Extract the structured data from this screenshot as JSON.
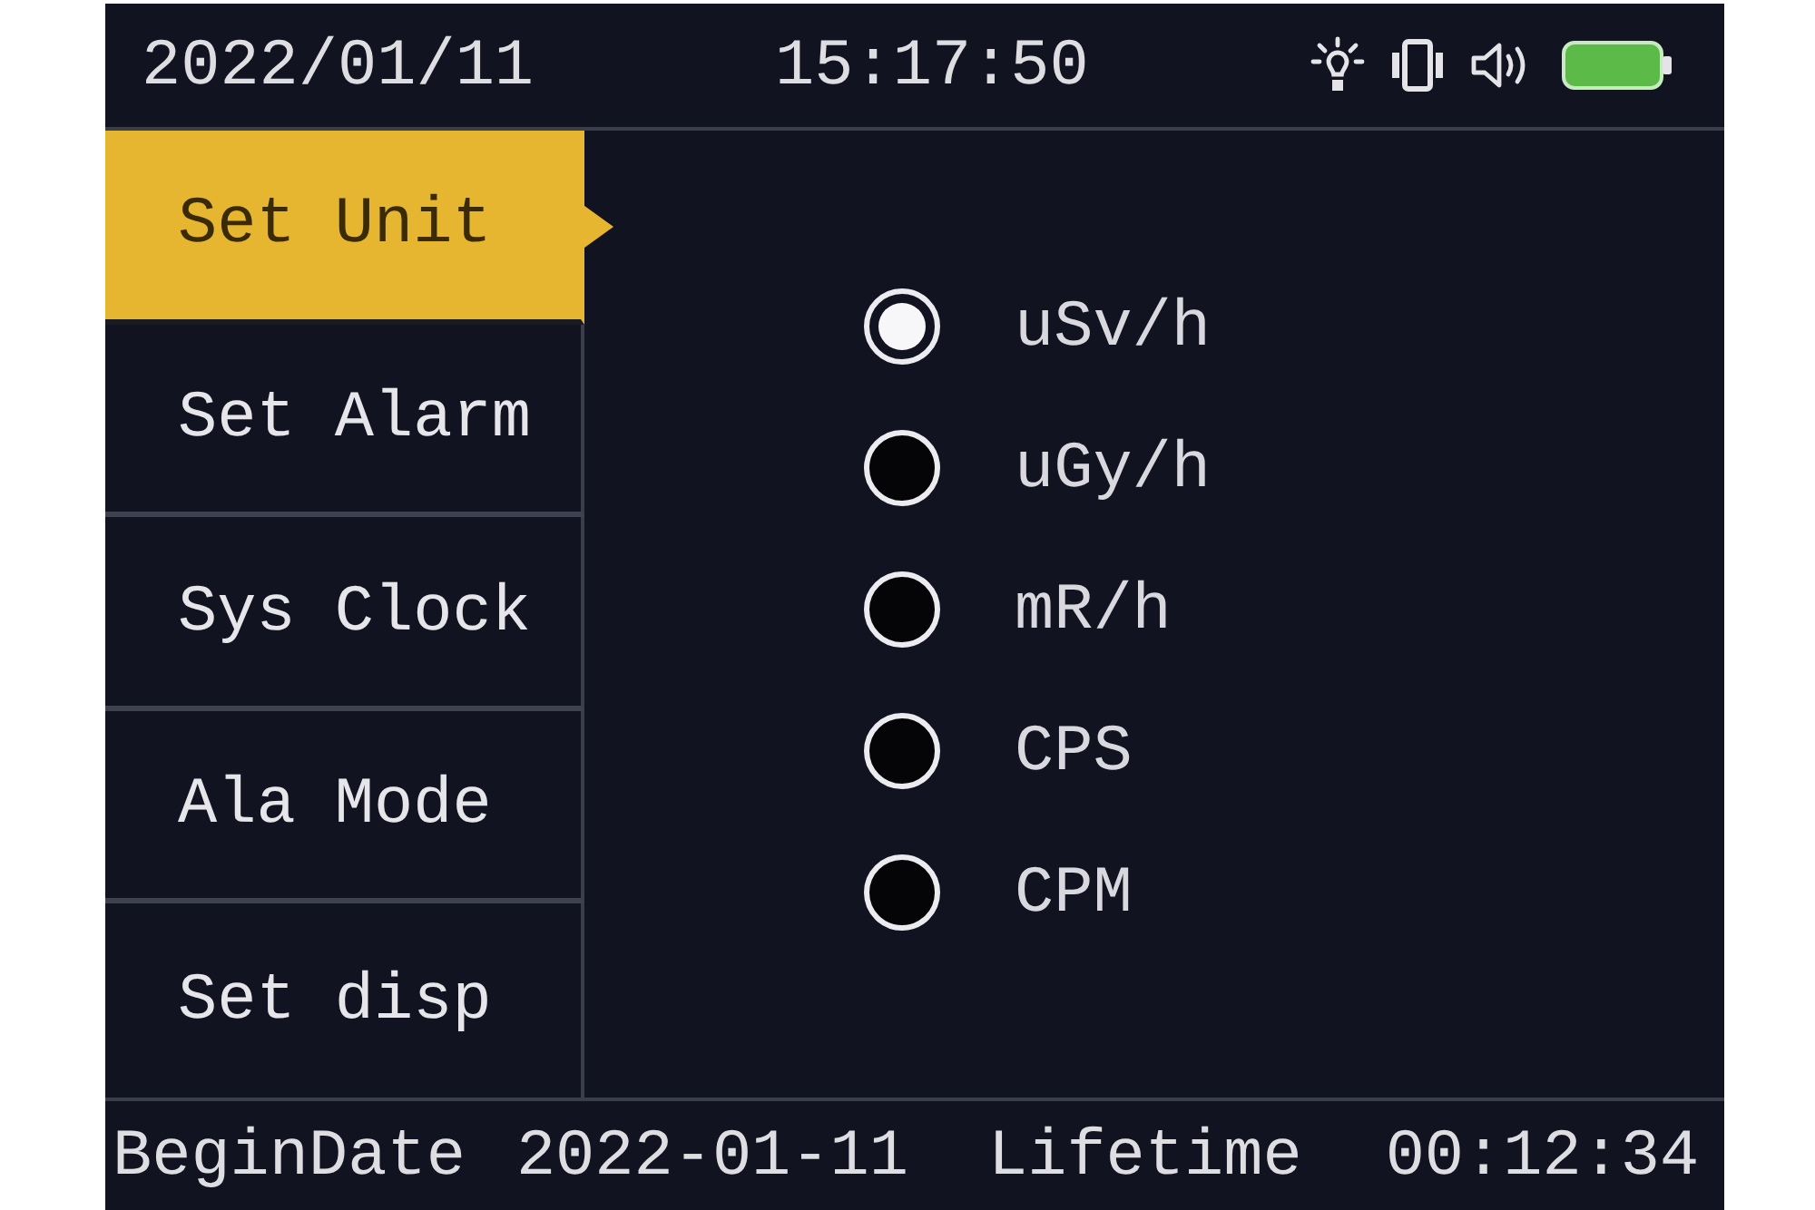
{
  "header": {
    "date": "2022/01/11",
    "time": "15:17:50"
  },
  "menu": {
    "items": [
      {
        "label": "Set Unit",
        "selected": true
      },
      {
        "label": "Set Alarm",
        "selected": false
      },
      {
        "label": "Sys Clock",
        "selected": false
      },
      {
        "label": "Ala Mode",
        "selected": false
      },
      {
        "label": "Set disp",
        "selected": false
      }
    ]
  },
  "units": {
    "options": [
      {
        "label": "uSv/h",
        "selected": true
      },
      {
        "label": "uGy/h",
        "selected": false
      },
      {
        "label": "mR/h",
        "selected": false
      },
      {
        "label": "CPS",
        "selected": false
      },
      {
        "label": "CPM",
        "selected": false
      }
    ]
  },
  "footer": {
    "begin_label": "BeginDate",
    "begin_date": "2022-01-11",
    "lifetime_label": "Lifetime",
    "lifetime": "00:12:34"
  }
}
